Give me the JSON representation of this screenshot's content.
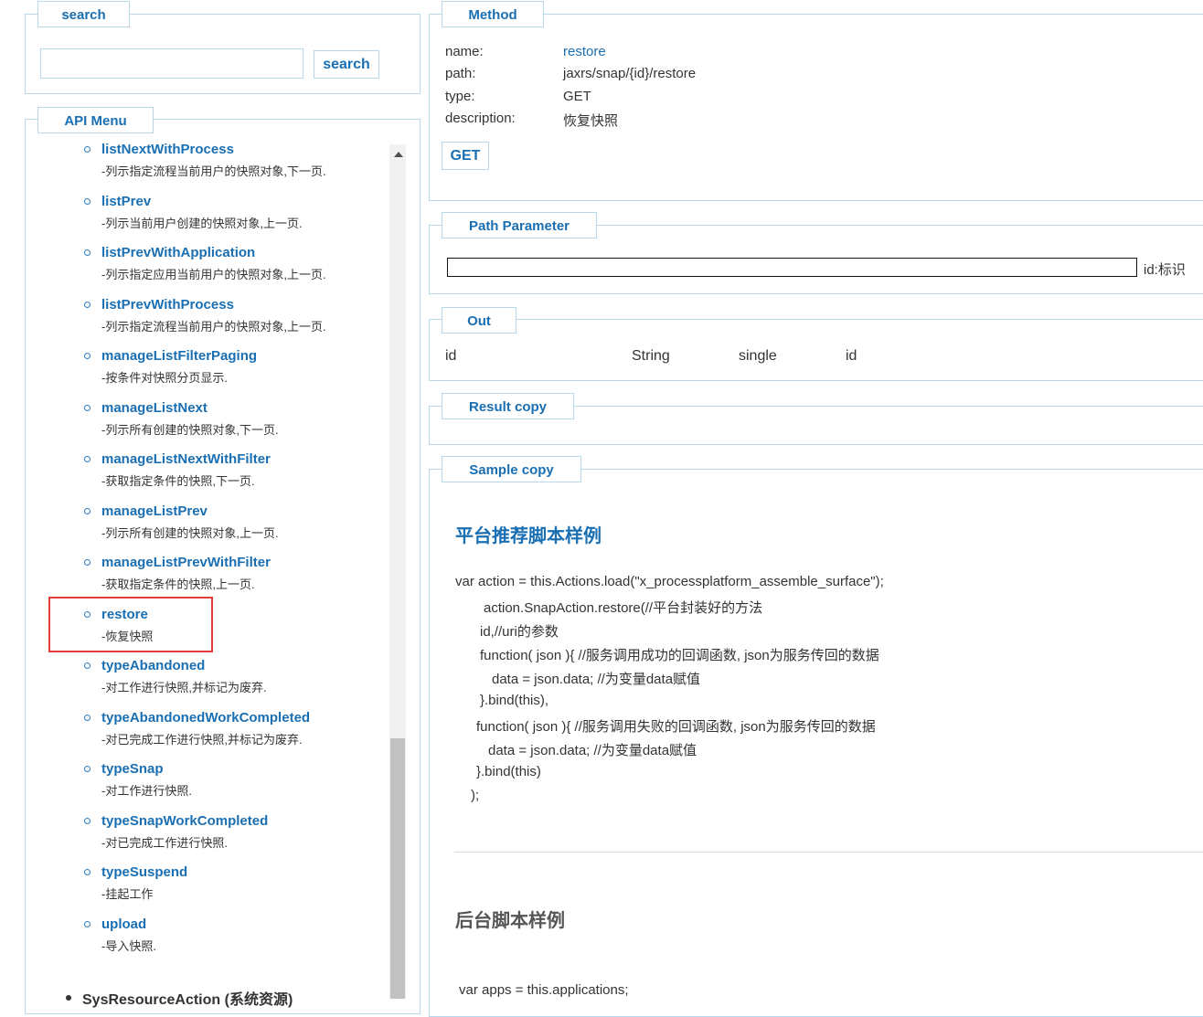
{
  "search": {
    "legend": "search",
    "input_value": "",
    "button_label": "search"
  },
  "api_menu": {
    "legend": "API Menu",
    "items": [
      {
        "name": "listNextWithProcess",
        "desc": "-列示指定流程当前用户的快照对象,下一页."
      },
      {
        "name": "listPrev",
        "desc": "-列示当前用户创建的快照对象,上一页."
      },
      {
        "name": "listPrevWithApplication",
        "desc": "-列示指定应用当前用户的快照对象,上一页."
      },
      {
        "name": "listPrevWithProcess",
        "desc": "-列示指定流程当前用户的快照对象,上一页."
      },
      {
        "name": "manageListFilterPaging",
        "desc": "-按条件对快照分页显示."
      },
      {
        "name": "manageListNext",
        "desc": "-列示所有创建的快照对象,下一页."
      },
      {
        "name": "manageListNextWithFilter",
        "desc": "-获取指定条件的快照,下一页."
      },
      {
        "name": "manageListPrev",
        "desc": "-列示所有创建的快照对象,上一页."
      },
      {
        "name": "manageListPrevWithFilter",
        "desc": "-获取指定条件的快照,上一页."
      },
      {
        "name": "restore",
        "desc": "-恢复快照"
      },
      {
        "name": "typeAbandoned",
        "desc": "-对工作进行快照,并标记为废弃."
      },
      {
        "name": "typeAbandonedWorkCompleted",
        "desc": "-对已完成工作进行快照,并标记为废弃."
      },
      {
        "name": "typeSnap",
        "desc": "-对工作进行快照."
      },
      {
        "name": "typeSnapWorkCompleted",
        "desc": "-对已完成工作进行快照."
      },
      {
        "name": "typeSuspend",
        "desc": "-挂起工作"
      },
      {
        "name": "upload",
        "desc": "-导入快照."
      }
    ],
    "next_group": "SysResourceAction (系统资源)"
  },
  "method": {
    "legend": "Method",
    "name_label": "name:",
    "name_value": "restore",
    "path_label": "path:",
    "path_value": "jaxrs/snap/{id}/restore",
    "type_label": "type:",
    "type_value": "GET",
    "description_label": "description:",
    "description_value": "恢复快照",
    "button_label": "GET"
  },
  "path_parameter": {
    "legend": "Path Parameter",
    "input_value": "",
    "hint": "id:标识"
  },
  "out": {
    "legend": "Out",
    "cells": [
      "id",
      "String",
      "single",
      "id"
    ]
  },
  "result": {
    "legend": "Result copy"
  },
  "sample": {
    "legend": "Sample copy",
    "heading1": "平台推荐脚本样例",
    "code1": [
      "var action = this.Actions.load(\"x_processplatform_assemble_surface\");",
      "action.SnapAction.restore(//平台封装好的方法",
      "id,//uri的参数",
      "function( json ){ //服务调用成功的回调函数, json为服务传回的数据",
      "data = json.data; //为变量data赋值",
      "}.bind(this),",
      "function( json ){ //服务调用失败的回调函数, json为服务传回的数据",
      "data = json.data; //为变量data赋值",
      "}.bind(this)",
      ");"
    ],
    "heading2": "后台脚本样例",
    "code2": "var apps = this.applications;"
  },
  "colors": {
    "accent": "#1a6fb3",
    "border": "#b9d7ea",
    "highlight": "#e23c3c"
  }
}
